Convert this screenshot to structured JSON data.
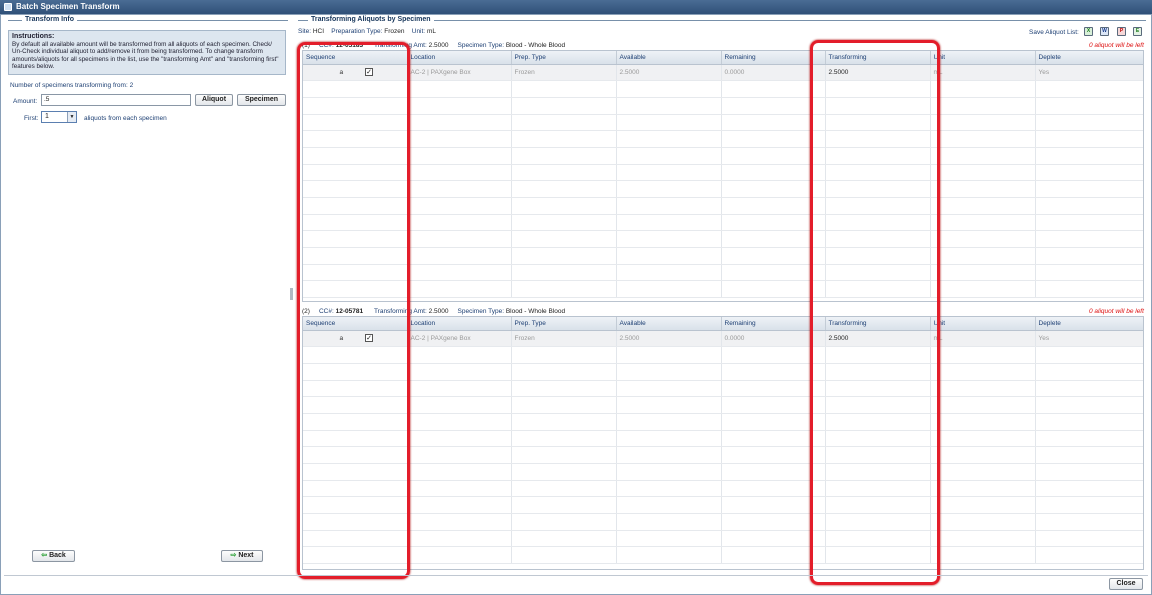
{
  "window": {
    "title": "Batch Specimen Transform"
  },
  "left": {
    "section_title": "Transform Info",
    "instructions_title": "Instructions:",
    "instructions_text": "By default all available amount will be transformed from all aliquots of each specimen. Check/ Un-Check individual aliquot to add/remove it from being transformed. To change transform amounts/aliquots for all specimens in the list, use the \"transforming Amt\" and \"transforming first\" features below.",
    "num_specimens_text": "Number of specimens transforming from: 2",
    "amount_label": "Amount:",
    "amount_value": ".5",
    "aliquot_button": "Aliquot",
    "specimen_button": "Specimen",
    "first_label": "First:",
    "first_value": "1",
    "first_suffix": "aliquots from each specimen",
    "back_button": "Back",
    "next_button": "Next"
  },
  "right": {
    "section_title": "Transforming Aliquots by Specimen",
    "site_label": "Site:",
    "site_value": "HCI",
    "prep_label": "Preparation Type:",
    "prep_value": "Frozen",
    "unit_label": "Unit:",
    "unit_value": "mL",
    "save_list_label": "Save Aliquot List:",
    "save_icons": [
      "excel-icon",
      "word-icon",
      "pdf-icon",
      "export-icon"
    ],
    "columns": [
      "Sequence",
      "Location",
      "Prep. Type",
      "Available",
      "Remaining",
      "Transforming",
      "Unit",
      "Deplete"
    ],
    "specimens": [
      {
        "index": "(1)",
        "cc_label": "CC#:",
        "cc_value": "12-05183",
        "amt_label": "Transforming Amt:",
        "amt_value": "2.5000",
        "type_label": "Specimen Type:",
        "type_value": "Blood - Whole Blood",
        "left_note": "0 aliquot will be left",
        "row": {
          "sequence": "a",
          "checked": "✓",
          "location": "AC-2 | PAXgene Box",
          "prep": "Frozen",
          "available": "2.5000",
          "remaining": "0.0000",
          "transforming": "2.5000",
          "unit": "mL",
          "deplete": "Yes"
        }
      },
      {
        "index": "(2)",
        "cc_label": "CC#:",
        "cc_value": "12-05781",
        "amt_label": "Transforming Amt:",
        "amt_value": "2.5000",
        "type_label": "Specimen Type:",
        "type_value": "Blood - Whole Blood",
        "left_note": "0 aliquot will be left",
        "row": {
          "sequence": "a",
          "checked": "✓",
          "location": "AC-2 | PAXgene Box",
          "prep": "Frozen",
          "available": "2.5000",
          "remaining": "0.0000",
          "transforming": "2.5000",
          "unit": "mL",
          "deplete": "Yes"
        }
      }
    ]
  },
  "footer": {
    "close_button": "Close"
  },
  "colors": {
    "highlight": "#e31d2a",
    "titlebar": "#2f5078"
  }
}
